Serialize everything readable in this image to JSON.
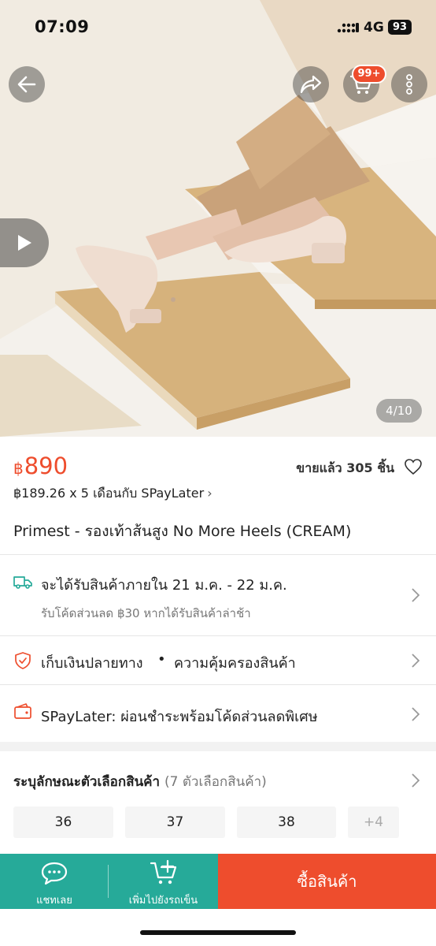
{
  "status_bar": {
    "time": "07:09",
    "network": "4G",
    "battery": "93"
  },
  "hero": {
    "cart_badge": "99+",
    "image_counter": "4/10"
  },
  "product": {
    "currency": "฿",
    "price": "890",
    "sold": "ขายแล้ว 305 ชิ้น",
    "installment": "฿189.26 x 5 เดือนกับ SPayLater",
    "title": "Primest - รองเท้าส้นสูง No More Heels (CREAM)"
  },
  "shipping": {
    "text": "จะได้รับสินค้าภายใน 21 ม.ค. - 22 ม.ค.",
    "sub": "รับโค้ดส่วนลด ฿30 หากได้รับสินค้าล่าช้า"
  },
  "guarantee": {
    "cod": "เก็บเงินปลายทาง",
    "separator": "•",
    "protection": "ความคุ้มครองสินค้า"
  },
  "spaylater": {
    "text": "SPayLater: ผ่อนชำระพร้อมโค้ดส่วนลดพิเศษ"
  },
  "variants": {
    "title": "ระบุลักษณะตัวเลือกสินค้า",
    "count": "(7 ตัวเลือกสินค้า)",
    "sizes": [
      "36",
      "37",
      "38"
    ],
    "more": "+4"
  },
  "bottom_bar": {
    "chat_label": "แชทเลย",
    "add_cart_label": "เพิ่มไปยังรถเข็น",
    "buy_label": "ซื้อสินค้า"
  },
  "colors": {
    "brand": "#ee4d2d",
    "teal": "#26aa99"
  },
  "icons": [
    "back-arrow-icon",
    "share-icon",
    "cart-icon",
    "more-vertical-icon",
    "play-icon",
    "heart-icon",
    "truck-icon",
    "shield-icon",
    "wallet-icon",
    "chevron-right-icon",
    "chat-icon",
    "cart-plus-icon"
  ]
}
